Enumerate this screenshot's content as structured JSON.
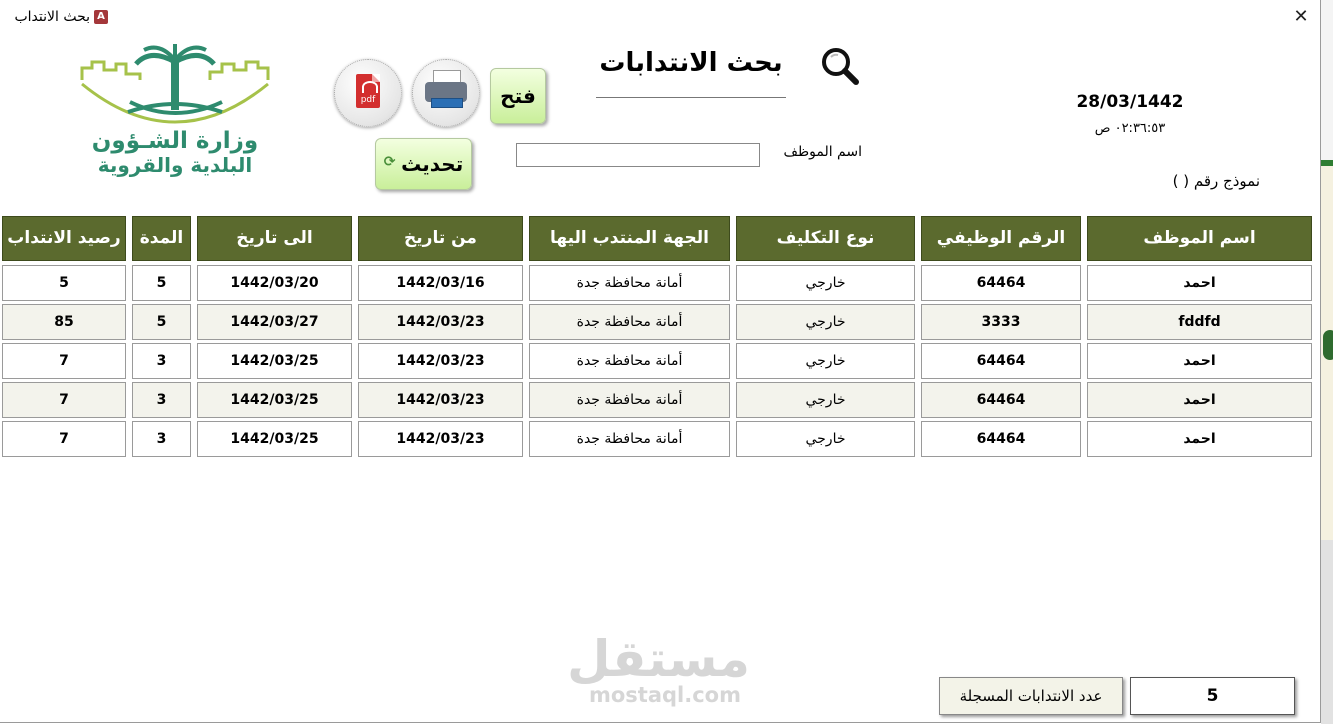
{
  "window": {
    "title": "بحث الانتداب",
    "app_icon": "A",
    "close": "✕"
  },
  "logo": {
    "line1": "وزارة الشـؤون",
    "line2": "البلدية والقروية",
    "color": "#2e8b6e"
  },
  "toolbar": {
    "open_label": "فتح",
    "refresh_label": "تحديث"
  },
  "heading": "بحث الانتدابات",
  "date": "28/03/1442",
  "time": "٠٢:٣٦:٥٣ ص",
  "form_no": "نموذج رقم (          )",
  "filter": {
    "label": "اسم الموظف",
    "value": "",
    "placeholder": ""
  },
  "table": {
    "headers": [
      "اسم الموظف",
      "الرقم الوظيفي",
      "نوع التكليف",
      "الجهة المنتدب اليها",
      "من تاريخ",
      "الى  تاريخ",
      "المدة",
      "رصيد الانتداب"
    ],
    "rows": [
      [
        "احمد",
        "64464",
        "خارجي",
        "أمانة محافظة جدة",
        "1442/03/16",
        "1442/03/20",
        "5",
        "5"
      ],
      [
        "fddfd",
        "3333",
        "خارجي",
        "أمانة محافظة جدة",
        "1442/03/23",
        "1442/03/27",
        "5",
        "85"
      ],
      [
        "احمد",
        "64464",
        "خارجي",
        "أمانة محافظة جدة",
        "1442/03/23",
        "1442/03/25",
        "3",
        "7"
      ],
      [
        "احمد",
        "64464",
        "خارجي",
        "أمانة محافظة جدة",
        "1442/03/23",
        "1442/03/25",
        "3",
        "7"
      ],
      [
        "احمد",
        "64464",
        "خارجي",
        "أمانة محافظة جدة",
        "1442/03/23",
        "1442/03/25",
        "3",
        "7"
      ]
    ]
  },
  "footer": {
    "count_label": "عدد الانتدابات المسجلة",
    "count_value": "5"
  },
  "watermark": {
    "ar": "مستقل",
    "en": "mostaql.com"
  },
  "colors": {
    "header_bg": "#5b6a2e",
    "button_green": "#c9ef9a",
    "alt_row": "#f3f3ec"
  }
}
